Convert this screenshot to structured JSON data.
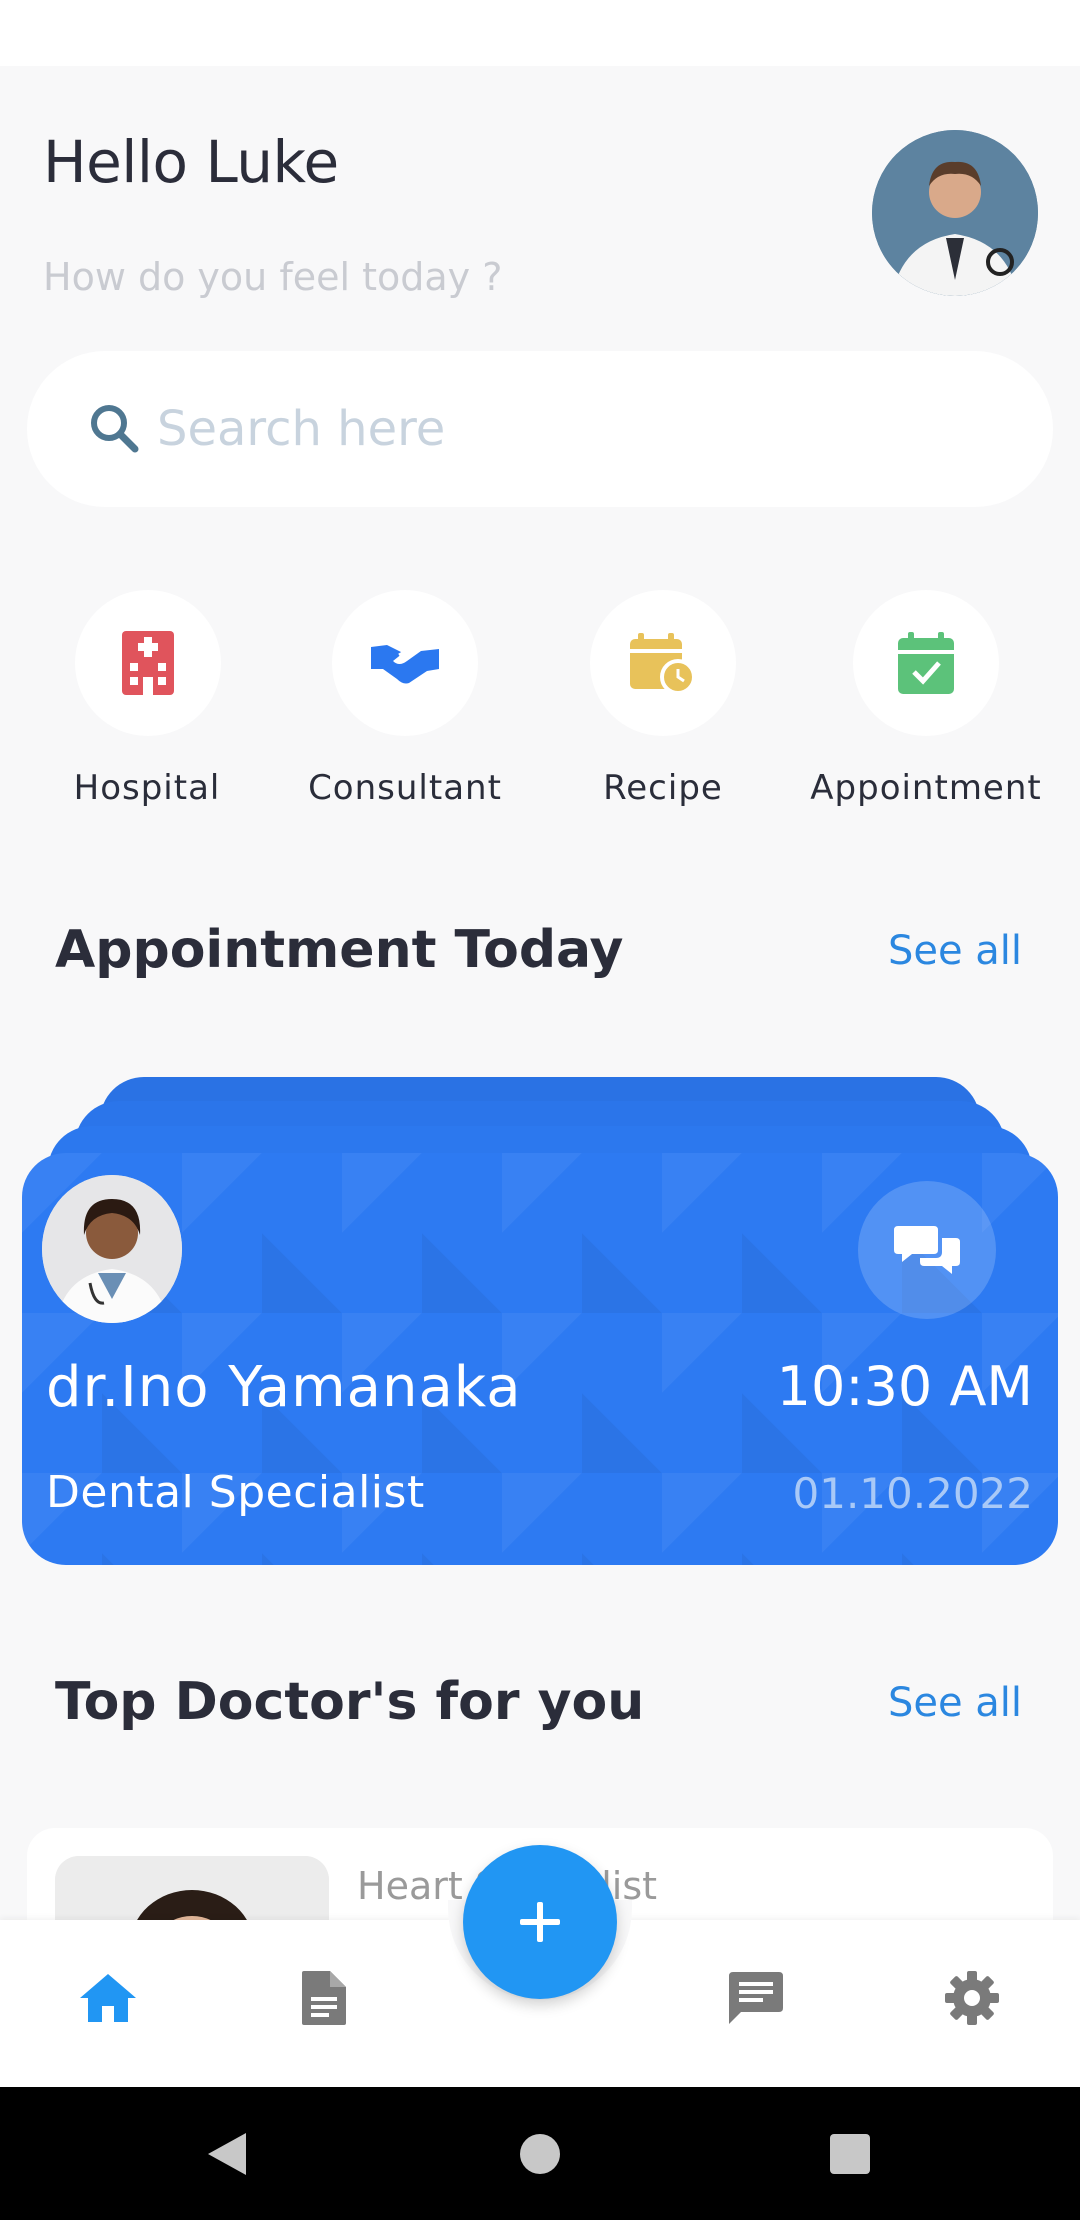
{
  "header": {
    "greeting": "Hello Luke",
    "subtitle": "How do you feel today ?"
  },
  "search": {
    "placeholder": "Search here",
    "value": ""
  },
  "categories": [
    {
      "label": "Hospital",
      "icon": "hospital-icon",
      "color": "#e0545c"
    },
    {
      "label": "Consultant",
      "icon": "handshake-icon",
      "color": "#2b78f0"
    },
    {
      "label": "Recipe",
      "icon": "calendar-clock-icon",
      "color": "#e8c25a"
    },
    {
      "label": "Appointment",
      "icon": "calendar-check-icon",
      "color": "#5cc27a"
    }
  ],
  "appointment_section": {
    "title": "Appointment Today",
    "see_all": "See all"
  },
  "appointment": {
    "doctor_name": "dr.Ino Yamanaka",
    "time": "10:30 AM",
    "specialty": "Dental Specialist",
    "date": "01.10.2022"
  },
  "top_doctors_section": {
    "title": "Top Doctor's for you",
    "see_all": "See all"
  },
  "top_doctor": {
    "specialty": "Heart Specialist"
  },
  "bottom_nav": {
    "items": [
      "home-icon",
      "document-icon",
      "add-icon",
      "chat-icon",
      "settings-icon"
    ],
    "active_color": "#2196f3",
    "inactive_color": "#7a7a7a"
  },
  "colors": {
    "accent": "#2196f3",
    "card": "#2d7af2",
    "link": "#2b87e0"
  }
}
